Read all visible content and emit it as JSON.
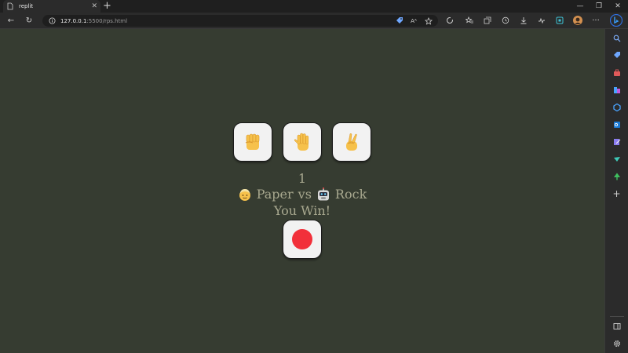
{
  "tab": {
    "title": "replit",
    "close": "✕"
  },
  "new_tab": "+",
  "window_controls": {
    "minimize": "—",
    "restore": "❐",
    "close": "✕"
  },
  "address_bar": {
    "host": "127.0.0.1",
    "path": ":5500/rps.html"
  },
  "address_icons": {
    "read_aloud": "Aᴬ"
  },
  "toolbar_icons": {
    "back": "←",
    "refresh": "↻",
    "more": "···"
  },
  "game": {
    "choices": [
      {
        "name": "rock",
        "icon": "raised-fist"
      },
      {
        "name": "paper",
        "icon": "raised-hand"
      },
      {
        "name": "scissors",
        "icon": "victory-hand"
      }
    ],
    "score": "1",
    "player_choice": "Paper",
    "vs": "vs",
    "computer_choice": "Rock",
    "result": "You Win!",
    "auto_play_color": "#f2303a"
  },
  "sidebar_icons": [
    "search",
    "tag",
    "briefcase",
    "games",
    "copilot",
    "outlook",
    "edit",
    "send",
    "tree",
    "plus",
    "split-screen",
    "settings"
  ],
  "sidebar_plus": "+"
}
